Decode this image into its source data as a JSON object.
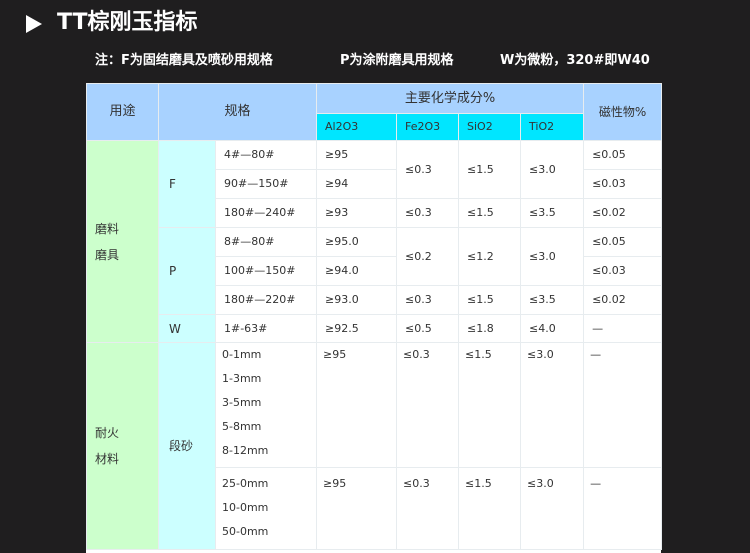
{
  "title": "TT棕刚玉指标",
  "note": {
    "f": "注：F为固结磨具及喷砂用规格",
    "p": "P为涂附磨具用规格",
    "w": "W为微粉，320#即W40"
  },
  "table": {
    "header": {
      "usage": "用途",
      "spec": "规格",
      "chem": "主要化学成分%",
      "al2o3": "Al2O3",
      "fe2o3": "Fe2O3",
      "sio2": "SiO2",
      "tio2": "TiO2",
      "magnetic": "磁性物%"
    },
    "abrasive_label": [
      "磨料",
      "磨具"
    ],
    "refractory_label": [
      "耐火",
      "材料"
    ],
    "groups": {
      "F": "F",
      "P": "P",
      "W": "W",
      "duan": "段砂"
    },
    "rows": {
      "F1": {
        "spec": "4#—80#",
        "al": "≥95",
        "fe": "≤0.3",
        "si": "≤1.5",
        "ti": "≤3.0",
        "mag": "≤0.05"
      },
      "F2": {
        "spec": "90#—150#",
        "al": "≥94",
        "mag": "≤0.03"
      },
      "F3": {
        "spec": "180#—240#",
        "al": "≥93",
        "fe": "≤0.3",
        "si": "≤1.5",
        "ti": "≤3.5",
        "mag": "≤0.02"
      },
      "P1": {
        "spec": "8#—80#",
        "al": "≥95.0",
        "fe": "≤0.2",
        "si": "≤1.2",
        "ti": "≤3.0",
        "mag": "≤0.05"
      },
      "P2": {
        "spec": "100#—150#",
        "al": "≥94.0",
        "mag": "≤0.03"
      },
      "P3": {
        "spec": "180#—220#",
        "al": "≥93.0",
        "fe": "≤0.3",
        "si": "≤1.5",
        "ti": "≤3.5",
        "mag": "≤0.02"
      },
      "W1": {
        "spec": "1#-63#",
        "al": "≥92.5",
        "fe": "≤0.5",
        "si": "≤1.8",
        "ti": "≤4.0",
        "mag": "—"
      }
    },
    "duan1": {
      "specs": [
        "0-1mm",
        "1-3mm",
        "3-5mm",
        "5-8mm",
        "8-12mm"
      ],
      "al": "≥95",
      "fe": "≤0.3",
      "si": "≤1.5",
      "ti": "≤3.0",
      "mag": "—"
    },
    "duan2": {
      "specs": [
        "25-0mm",
        "10-0mm",
        "50-0mm"
      ],
      "al": "≥95",
      "fe": "≤0.3",
      "si": "≤1.5",
      "ti": "≤3.0",
      "mag": "—"
    }
  }
}
